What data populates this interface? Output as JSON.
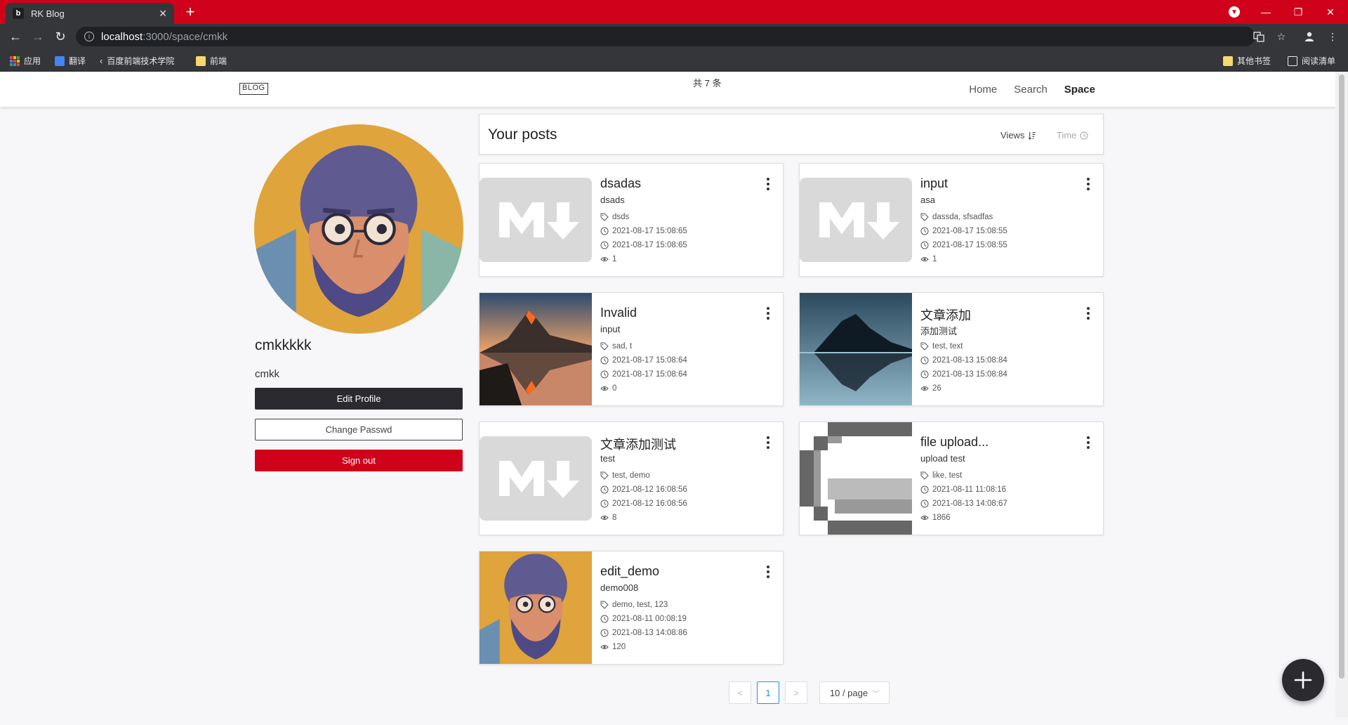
{
  "browser": {
    "tab_title": "RK Blog",
    "tab_favicon": "b",
    "url_host": "localhost",
    "url_path": ":3000/space/cmkk",
    "bookmarks": [
      "应用",
      "翻译",
      "百度前端技术学院",
      "前端"
    ],
    "bookmarks_right": [
      "其他书签",
      "阅读清单"
    ]
  },
  "header": {
    "logo": "BLOG",
    "nav": [
      "Home",
      "Search",
      "Space"
    ],
    "active_nav": "Space"
  },
  "profile": {
    "username": "cmkkkkk",
    "nickname": "cmkk",
    "edit_label": "Edit Profile",
    "password_label": "Change Passwd",
    "signout_label": "Sign out"
  },
  "posts_header": {
    "title": "Your posts",
    "sort_views": "Views",
    "sort_time": "Time"
  },
  "posts": [
    {
      "title": "dsadas",
      "desc": "dsads",
      "tags": "dsds",
      "created": "2021-08-17 15:08:65",
      "updated": "2021-08-17 15:08:65",
      "views": "1",
      "thumb": "md-logo"
    },
    {
      "title": "input",
      "desc": "asa",
      "tags": "dassda, sfsadfas",
      "created": "2021-08-17 15:08:55",
      "updated": "2021-08-17 15:08:55",
      "views": "1",
      "thumb": "md-logo"
    },
    {
      "title": "Invalid",
      "desc": "input",
      "tags": "sad, t",
      "created": "2021-08-17 15:08:64",
      "updated": "2021-08-17 15:08:64",
      "views": "0",
      "thumb": "mountain-sunset"
    },
    {
      "title": "文章添加",
      "desc": "添加测试",
      "tags": "test, text",
      "created": "2021-08-13 15:08:84",
      "updated": "2021-08-13 15:08:84",
      "views": "26",
      "thumb": "mountain-lake"
    },
    {
      "title": "文章添加测试",
      "desc": "test",
      "tags": "test, demo",
      "created": "2021-08-12 16:08:56",
      "updated": "2021-08-12 16:08:56",
      "views": "8",
      "thumb": "md-logo"
    },
    {
      "title": "file upload...",
      "desc": "upload test",
      "tags": "like, test",
      "created": "2021-08-11 11:08:16",
      "updated": "2021-08-13 14:08:67",
      "views": "1866",
      "thumb": "pixel-c"
    },
    {
      "title": "edit_demo",
      "desc": "demo008",
      "tags": "demo, test, 123",
      "created": "2021-08-11 00:08:19",
      "updated": "2021-08-13 14:08:86",
      "views": "120",
      "thumb": "avatar"
    }
  ],
  "pagination": {
    "total": "共 7 条",
    "current": "1",
    "prev": "<",
    "next": ">",
    "page_size": "10 / page"
  },
  "colors": {
    "brand_red": "#d0021b",
    "dark_button": "#2b2b2f",
    "pager_active": "#1890ff"
  }
}
